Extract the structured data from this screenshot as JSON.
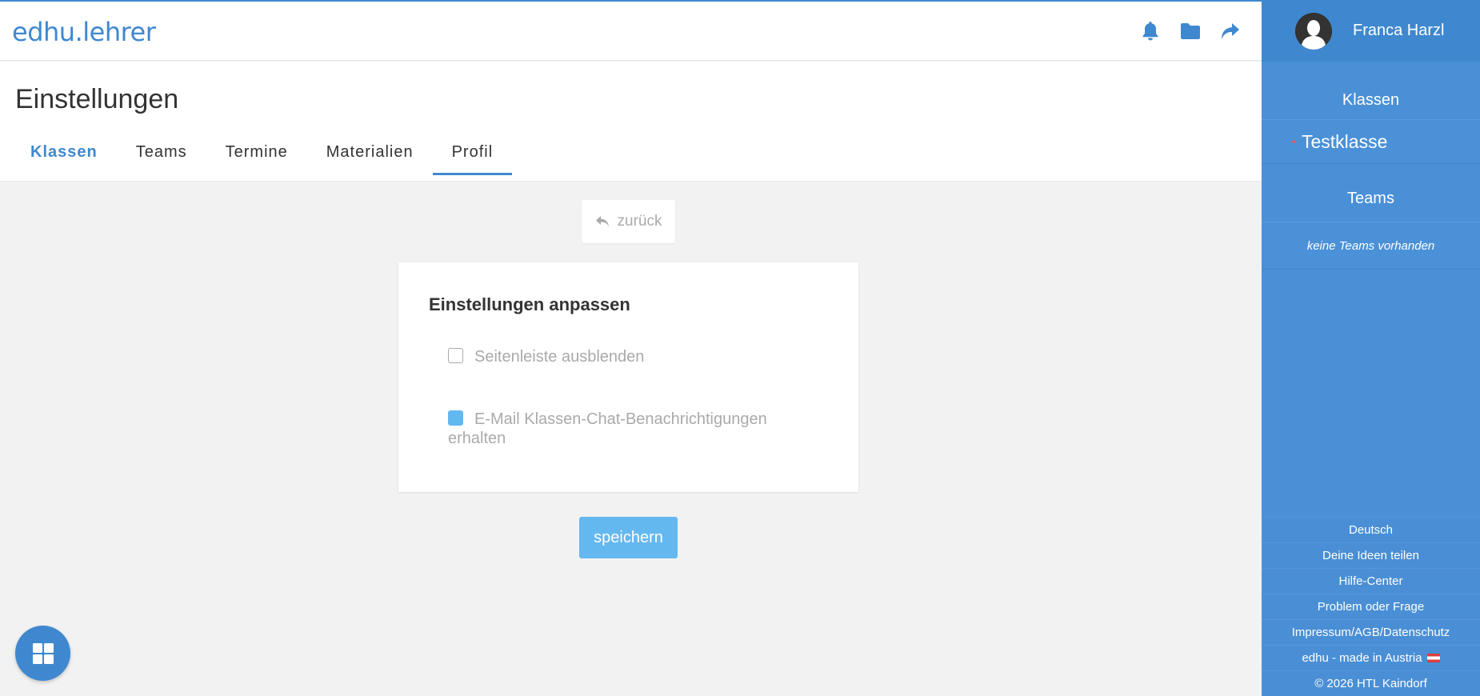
{
  "header": {
    "logo": "edhu.lehrer",
    "icons": [
      "bell-icon",
      "folder-icon",
      "share-icon"
    ],
    "accent_color": "#3f88cf"
  },
  "page": {
    "title": "Einstellungen",
    "tabs": [
      {
        "label": "Klassen"
      },
      {
        "label": "Teams"
      },
      {
        "label": "Termine"
      },
      {
        "label": "Materialien"
      },
      {
        "label": "Profil"
      }
    ]
  },
  "main": {
    "back_label": "zurück",
    "card_title": "Einstellungen anpassen",
    "options": [
      {
        "label": "Seitenleiste ausblenden",
        "checked": false
      },
      {
        "label": "E-Mail Klassen-Chat-Benachrichtigungen erhalten",
        "checked": true
      }
    ],
    "save_label": "speichern"
  },
  "sidebar": {
    "user_name": "Franca Harzl",
    "classes_title": "Klassen",
    "classes": [
      {
        "label": "Testklasse"
      }
    ],
    "teams_title": "Teams",
    "teams_empty": "keine Teams vorhanden",
    "footer_links": [
      {
        "label": "Deutsch"
      },
      {
        "label": "Deine Ideen teilen"
      },
      {
        "label": "Hilfe-Center"
      },
      {
        "label": "Problem oder Frage"
      },
      {
        "label": "Impressum/AGB/Datenschutz"
      },
      {
        "label": "edhu - made in Austria"
      },
      {
        "label": "© 2026 HTL Kaindorf"
      }
    ]
  }
}
